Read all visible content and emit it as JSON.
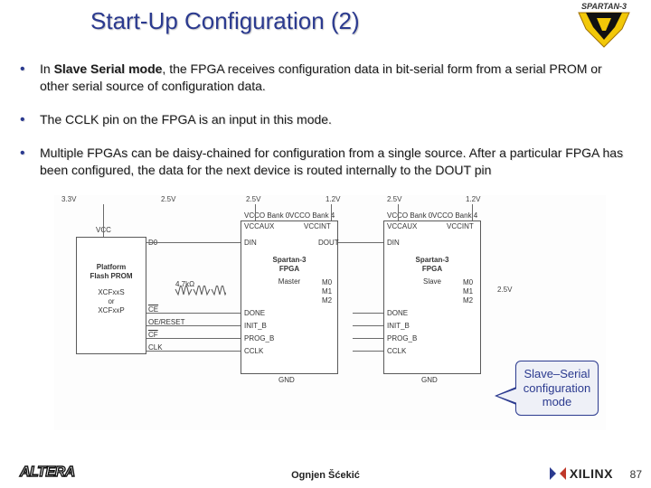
{
  "title": "Start-Up Configuration (2)",
  "header_logo_name": "SPARTAN-3",
  "bullets": {
    "b1_pre": "In ",
    "b1_strong": "Slave Serial mode",
    "b1_post": ", the FPGA receives configuration data in bit-serial form from a serial PROM or other serial source of configuration data.",
    "b2": "The CCLK pin on the FPGA is an input in this mode.",
    "b3": "Multiple FPGAs can be daisy-chained for configuration from a single source. After a particular FPGA has been configured, the data for the next device is routed internally to the DOUT pin"
  },
  "diagram": {
    "volts": {
      "v33": "3.3V",
      "v25a": "2.5V",
      "v25b": "2.5V",
      "v12a": "1.2V",
      "v25c": "2.5V",
      "v12b": "1.2V",
      "v25d": "2.5V"
    },
    "prom": {
      "title1": "Platform",
      "title2": "Flash PROM",
      "sub1": "XCFxxS",
      "sub_or": "or",
      "sub2": "XCFxxP"
    },
    "prom_pins": {
      "vcc": "VCC",
      "d0": "D0",
      "ceb": "CE",
      "resetb": "OE/RESET",
      "cf": "CF",
      "clk": "CLK"
    },
    "res": "4.7kΩ",
    "fpga1": {
      "name": "Spartan-3",
      "sub": "FPGA",
      "role": "Master"
    },
    "fpga2": {
      "name": "Spartan-3",
      "sub": "FPGA",
      "role": "Slave"
    },
    "fpga_pins": {
      "vbank0": "VCCO Bank 0",
      "vbank4": "VCCO Bank 4",
      "vccaux": "VCCAUX",
      "vccint": "VCCINT",
      "din": "DIN",
      "dout": "DOUT",
      "done": "DONE",
      "initb": "INIT_B",
      "progb": "PROG_B",
      "cclk": "CCLK",
      "m0": "M0",
      "m1": "M1",
      "m2": "M2",
      "gnd": "GND"
    }
  },
  "callout": "Slave–Serial configuration mode",
  "footer": {
    "altera": "ALTERA",
    "author": "Ognjen Šćekić",
    "xilinx": "XILINX",
    "page": "87"
  }
}
